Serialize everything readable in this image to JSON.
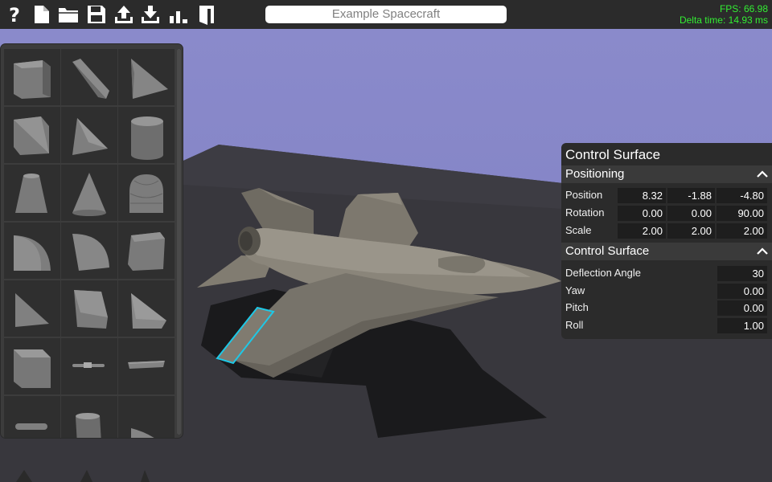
{
  "toolbar": {
    "buttons": [
      {
        "icon": "help-icon"
      },
      {
        "icon": "new-file-icon"
      },
      {
        "icon": "open-folder-icon"
      },
      {
        "icon": "save-icon"
      },
      {
        "icon": "upload-icon"
      },
      {
        "icon": "download-icon"
      },
      {
        "icon": "stats-icon"
      },
      {
        "icon": "exit-icon"
      }
    ],
    "title_value": "Example Spacecraft"
  },
  "perf": {
    "fps": "FPS: 66.98",
    "delta": "Delta time: 14.93 ms"
  },
  "palette": {
    "parts": [
      "cube",
      "wedge",
      "tetrahedron",
      "corner-cube",
      "corner-wedge",
      "cylinder",
      "cone-frustum",
      "cone",
      "dome",
      "quarter-round",
      "quarter-sphere",
      "beveled-block",
      "triangle-prism",
      "slanted-block",
      "slope-wedge",
      "block",
      "antenna",
      "flat-panel",
      "capsule",
      "thruster",
      "fin"
    ]
  },
  "properties": {
    "title": "Control Surface",
    "positioning": {
      "header": "Positioning",
      "rows": [
        {
          "label": "Position",
          "values": [
            "8.32",
            "-1.88",
            "-4.80"
          ]
        },
        {
          "label": "Rotation",
          "values": [
            "0.00",
            "0.00",
            "90.00"
          ]
        },
        {
          "label": "Scale",
          "values": [
            "2.00",
            "2.00",
            "2.00"
          ]
        }
      ]
    },
    "control_surface": {
      "header": "Control Surface",
      "rows": [
        {
          "label": "Deflection Angle",
          "value": "30"
        },
        {
          "label": "Yaw",
          "value": "0.00"
        },
        {
          "label": "Pitch",
          "value": "0.00"
        },
        {
          "label": "Roll",
          "value": "1.00"
        }
      ]
    }
  },
  "colors": {
    "sky": "#8585c6",
    "ground": "#37363c",
    "panel": "#2b2b2b",
    "fps_text": "#33ee33",
    "selection": "#1ec8e6",
    "model": "#77736a"
  }
}
